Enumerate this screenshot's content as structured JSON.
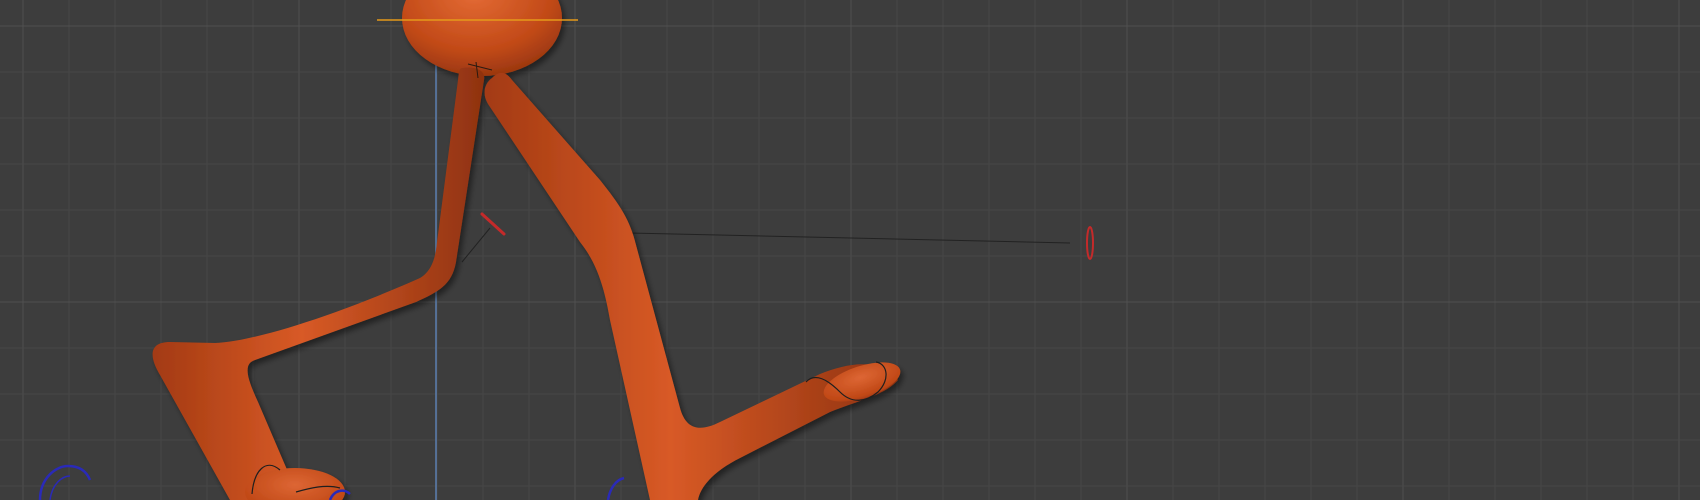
{
  "viewport": {
    "background_color": "#3d3d3d",
    "grid_minor_color": "#474747",
    "grid_major_color": "#505050"
  },
  "character": {
    "body_color": "#c24a18",
    "body_highlight": "#df6a3a",
    "body_shadow": "#8a2f0c"
  },
  "rig": {
    "ik_control_color": "#c42a2a",
    "foot_control_color": "#2a2ab8",
    "vertical_axis_color": "#5b7fb0",
    "selection_outline_color": "#e59a1a",
    "relationship_line_color": "#222222"
  }
}
